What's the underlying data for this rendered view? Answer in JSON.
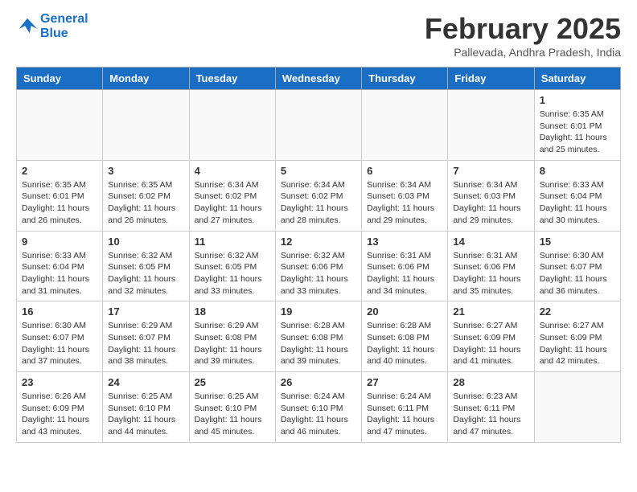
{
  "header": {
    "logo_line1": "General",
    "logo_line2": "Blue",
    "month": "February 2025",
    "location": "Pallevada, Andhra Pradesh, India"
  },
  "weekdays": [
    "Sunday",
    "Monday",
    "Tuesday",
    "Wednesday",
    "Thursday",
    "Friday",
    "Saturday"
  ],
  "weeks": [
    [
      {
        "day": "",
        "info": ""
      },
      {
        "day": "",
        "info": ""
      },
      {
        "day": "",
        "info": ""
      },
      {
        "day": "",
        "info": ""
      },
      {
        "day": "",
        "info": ""
      },
      {
        "day": "",
        "info": ""
      },
      {
        "day": "1",
        "info": "Sunrise: 6:35 AM\nSunset: 6:01 PM\nDaylight: 11 hours and 25 minutes."
      }
    ],
    [
      {
        "day": "2",
        "info": "Sunrise: 6:35 AM\nSunset: 6:01 PM\nDaylight: 11 hours and 26 minutes."
      },
      {
        "day": "3",
        "info": "Sunrise: 6:35 AM\nSunset: 6:02 PM\nDaylight: 11 hours and 26 minutes."
      },
      {
        "day": "4",
        "info": "Sunrise: 6:34 AM\nSunset: 6:02 PM\nDaylight: 11 hours and 27 minutes."
      },
      {
        "day": "5",
        "info": "Sunrise: 6:34 AM\nSunset: 6:02 PM\nDaylight: 11 hours and 28 minutes."
      },
      {
        "day": "6",
        "info": "Sunrise: 6:34 AM\nSunset: 6:03 PM\nDaylight: 11 hours and 29 minutes."
      },
      {
        "day": "7",
        "info": "Sunrise: 6:34 AM\nSunset: 6:03 PM\nDaylight: 11 hours and 29 minutes."
      },
      {
        "day": "8",
        "info": "Sunrise: 6:33 AM\nSunset: 6:04 PM\nDaylight: 11 hours and 30 minutes."
      }
    ],
    [
      {
        "day": "9",
        "info": "Sunrise: 6:33 AM\nSunset: 6:04 PM\nDaylight: 11 hours and 31 minutes."
      },
      {
        "day": "10",
        "info": "Sunrise: 6:32 AM\nSunset: 6:05 PM\nDaylight: 11 hours and 32 minutes."
      },
      {
        "day": "11",
        "info": "Sunrise: 6:32 AM\nSunset: 6:05 PM\nDaylight: 11 hours and 33 minutes."
      },
      {
        "day": "12",
        "info": "Sunrise: 6:32 AM\nSunset: 6:06 PM\nDaylight: 11 hours and 33 minutes."
      },
      {
        "day": "13",
        "info": "Sunrise: 6:31 AM\nSunset: 6:06 PM\nDaylight: 11 hours and 34 minutes."
      },
      {
        "day": "14",
        "info": "Sunrise: 6:31 AM\nSunset: 6:06 PM\nDaylight: 11 hours and 35 minutes."
      },
      {
        "day": "15",
        "info": "Sunrise: 6:30 AM\nSunset: 6:07 PM\nDaylight: 11 hours and 36 minutes."
      }
    ],
    [
      {
        "day": "16",
        "info": "Sunrise: 6:30 AM\nSunset: 6:07 PM\nDaylight: 11 hours and 37 minutes."
      },
      {
        "day": "17",
        "info": "Sunrise: 6:29 AM\nSunset: 6:07 PM\nDaylight: 11 hours and 38 minutes."
      },
      {
        "day": "18",
        "info": "Sunrise: 6:29 AM\nSunset: 6:08 PM\nDaylight: 11 hours and 39 minutes."
      },
      {
        "day": "19",
        "info": "Sunrise: 6:28 AM\nSunset: 6:08 PM\nDaylight: 11 hours and 39 minutes."
      },
      {
        "day": "20",
        "info": "Sunrise: 6:28 AM\nSunset: 6:08 PM\nDaylight: 11 hours and 40 minutes."
      },
      {
        "day": "21",
        "info": "Sunrise: 6:27 AM\nSunset: 6:09 PM\nDaylight: 11 hours and 41 minutes."
      },
      {
        "day": "22",
        "info": "Sunrise: 6:27 AM\nSunset: 6:09 PM\nDaylight: 11 hours and 42 minutes."
      }
    ],
    [
      {
        "day": "23",
        "info": "Sunrise: 6:26 AM\nSunset: 6:09 PM\nDaylight: 11 hours and 43 minutes."
      },
      {
        "day": "24",
        "info": "Sunrise: 6:25 AM\nSunset: 6:10 PM\nDaylight: 11 hours and 44 minutes."
      },
      {
        "day": "25",
        "info": "Sunrise: 6:25 AM\nSunset: 6:10 PM\nDaylight: 11 hours and 45 minutes."
      },
      {
        "day": "26",
        "info": "Sunrise: 6:24 AM\nSunset: 6:10 PM\nDaylight: 11 hours and 46 minutes."
      },
      {
        "day": "27",
        "info": "Sunrise: 6:24 AM\nSunset: 6:11 PM\nDaylight: 11 hours and 47 minutes."
      },
      {
        "day": "28",
        "info": "Sunrise: 6:23 AM\nSunset: 6:11 PM\nDaylight: 11 hours and 47 minutes."
      },
      {
        "day": "",
        "info": ""
      }
    ]
  ]
}
